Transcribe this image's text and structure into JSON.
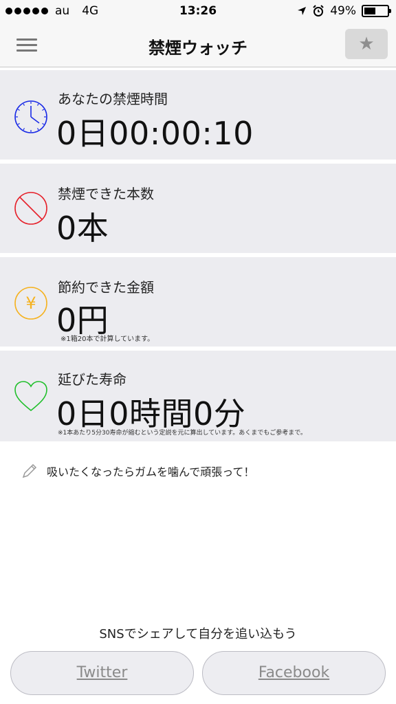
{
  "status_bar": {
    "carrier": "au",
    "network": "4G",
    "time": "13:26",
    "battery": "49%",
    "battery_level": 0.49
  },
  "nav": {
    "title": "禁煙ウォッチ",
    "menu_icon": "hamburger-icon",
    "favorite_icon": "star-icon",
    "favorite_glyph": "★"
  },
  "cards": [
    {
      "label": "あなたの禁煙時間",
      "value": "0日00:00:10",
      "icon": "clock-icon",
      "color": "#1a2be6"
    },
    {
      "label": "禁煙できた本数",
      "value": "0本",
      "icon": "prohibited-icon",
      "color": "#e6202a"
    },
    {
      "label": "節約できた金額",
      "value": "0円",
      "note": "※1箱20本で計算しています。",
      "icon": "yen-icon",
      "yen_glyph": "¥",
      "color": "#f5b21f"
    },
    {
      "label": "延びた寿命",
      "value": "0日0時間0分",
      "note": "※1本あたり5分30寿命が縮むという定説を元に算出しています。あくまでもご参考まで。",
      "icon": "heart-icon",
      "color": "#1fbf2a"
    }
  ],
  "tip": {
    "text": "吸いたくなったらガムを噛んで頑張って！",
    "icon": "pencil-icon"
  },
  "share": {
    "text": "SNSでシェアして自分を追い込もう",
    "twitter": "Twitter",
    "facebook": "Facebook"
  }
}
